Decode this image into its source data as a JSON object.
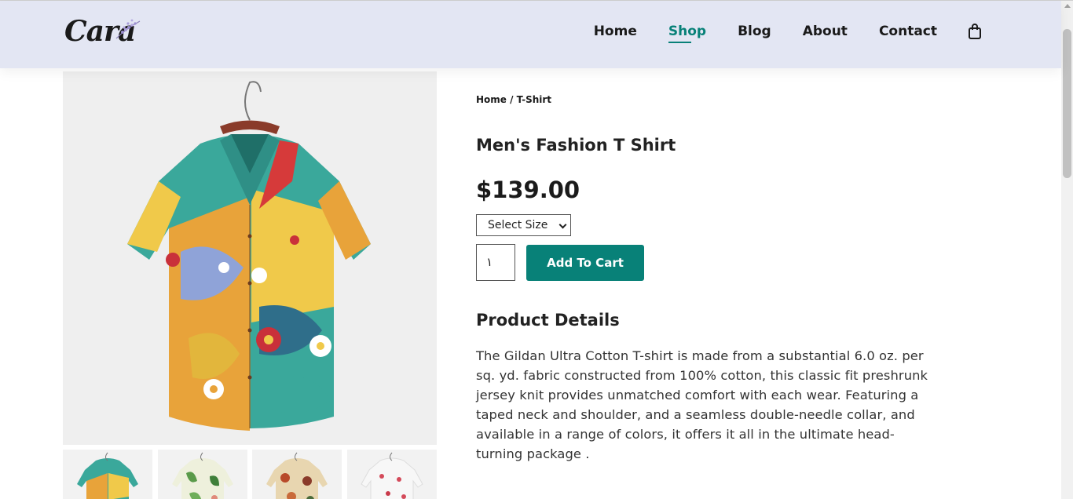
{
  "header": {
    "logo_text": "Cara",
    "nav": [
      {
        "label": "Home",
        "active": false
      },
      {
        "label": "Shop",
        "active": true
      },
      {
        "label": "Blog",
        "active": false
      },
      {
        "label": "About",
        "active": false
      },
      {
        "label": "Contact",
        "active": false
      }
    ],
    "cart_icon": "shopping-bag-icon"
  },
  "gallery": {
    "main_image": "multicolor-floral-shirt",
    "thumbnails": [
      "multicolor-floral-shirt",
      "green-leaf-print-shirt",
      "brown-floral-print-shirt",
      "white-red-floral-shirt"
    ]
  },
  "product": {
    "breadcrumb": "Home / T-Shirt",
    "title": "Men's Fashion T Shirt",
    "price": "$139.00",
    "size_select": "Select Size",
    "quantity": "١",
    "add_to_cart": "Add To Cart",
    "details_heading": "Product Details",
    "description": "The Gildan Ultra Cotton T-shirt is made from a substantial 6.0 oz. per sq. yd. fabric constructed from 100% cotton, this classic fit preshrunk jersey knit provides unmatched comfort with each wear. Featuring a taped neck and shoulder, and a seamless double-needle collar, and available in a range of colors, it offers it all in the ultimate head-turning package ."
  },
  "colors": {
    "header_bg": "#e3e6f3",
    "accent": "#088178"
  }
}
